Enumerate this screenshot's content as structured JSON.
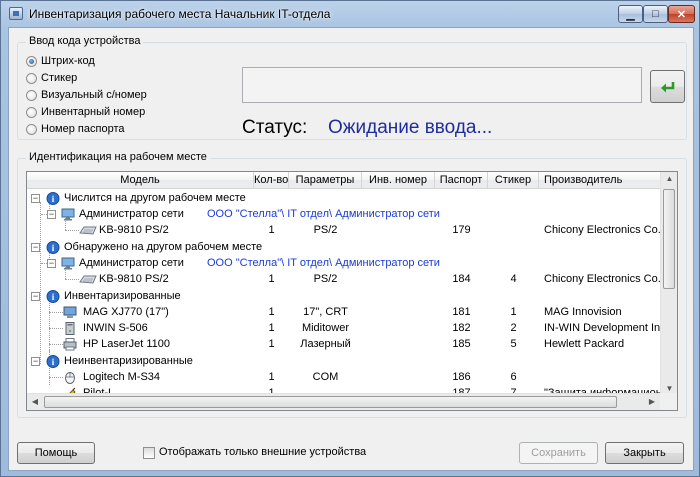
{
  "window": {
    "title": "Инвентаризация рабочего места Начальник IT-отдела",
    "min_glyph": "▁",
    "max_glyph": "□",
    "close_glyph": "✕"
  },
  "code_entry": {
    "legend": "Ввод кода устройства",
    "options": [
      {
        "label": "Штрих-код",
        "selected": true
      },
      {
        "label": "Стикер",
        "selected": false
      },
      {
        "label": "Визуальный с/номер",
        "selected": false
      },
      {
        "label": "Инвентарный номер",
        "selected": false
      },
      {
        "label": "Номер паспорта",
        "selected": false
      }
    ],
    "input_value": "",
    "status_label": "Статус:",
    "status_value": "Ожидание ввода..."
  },
  "identification": {
    "legend": "Идентификация на рабочем месте",
    "columns": [
      "Модель",
      "Кол-во",
      "Параметры",
      "Инв. номер",
      "Паспорт",
      "Стикер",
      "Производитель"
    ],
    "rows": [
      {
        "model": "Числится на другом рабочем месте",
        "qty": "",
        "params": "",
        "inv": "",
        "passport": "",
        "sticker": "",
        "maker": ""
      },
      {
        "model": "Администратор сети",
        "qty": "",
        "params": "ООО \"Стелла\"\\ IT отдел\\ Администратор сети",
        "inv": "",
        "passport": "",
        "sticker": "",
        "maker": ""
      },
      {
        "model": "KB-9810 PS/2",
        "qty": "1",
        "params": "PS/2",
        "inv": "",
        "passport": "179",
        "sticker": "",
        "maker": "Chicony Electronics Co., Ltd"
      },
      {
        "model": "Обнаружено на другом рабочем месте",
        "qty": "",
        "params": "",
        "inv": "",
        "passport": "",
        "sticker": "",
        "maker": ""
      },
      {
        "model": "Администратор сети",
        "qty": "",
        "params": "ООО \"Стелла\"\\ IT отдел\\ Администратор сети",
        "inv": "",
        "passport": "",
        "sticker": "",
        "maker": ""
      },
      {
        "model": "KB-9810 PS/2",
        "qty": "1",
        "params": "PS/2",
        "inv": "",
        "passport": "184",
        "sticker": "4",
        "maker": "Chicony Electronics Co., Ltd"
      },
      {
        "model": "Инвентаризированные",
        "qty": "",
        "params": "",
        "inv": "",
        "passport": "",
        "sticker": "",
        "maker": ""
      },
      {
        "model": "MAG XJ770 (17\")",
        "qty": "1",
        "params": "17\", CRT",
        "inv": "",
        "passport": "181",
        "sticker": "1",
        "maker": "MAG Innovision"
      },
      {
        "model": "INWIN S-506",
        "qty": "1",
        "params": "Miditower",
        "inv": "",
        "passport": "182",
        "sticker": "2",
        "maker": "IN-WIN Development Inc."
      },
      {
        "model": "HP LaserJet 1100",
        "qty": "1",
        "params": "Лазерный",
        "inv": "",
        "passport": "185",
        "sticker": "5",
        "maker": "Hewlett Packard"
      },
      {
        "model": "Неинвентаризированные",
        "qty": "",
        "params": "",
        "inv": "",
        "passport": "",
        "sticker": "",
        "maker": ""
      },
      {
        "model": "Logitech M-S34",
        "qty": "1",
        "params": "COM",
        "inv": "",
        "passport": "186",
        "sticker": "6",
        "maker": ""
      },
      {
        "model": "Pilot-L",
        "qty": "1",
        "params": "",
        "inv": "",
        "passport": "187",
        "sticker": "7",
        "maker": "\"Защита информационных ..."
      }
    ]
  },
  "footer": {
    "help": "Помощь",
    "external_only": "Отображать только внешние устройства",
    "external_only_checked": false,
    "save": "Сохранить",
    "close": "Закрыть"
  },
  "colors": {
    "status": "#1f2d9c",
    "link": "#1c3bd6",
    "enter_arrow": "#2a9a2a"
  },
  "icons": {
    "group": "info-icon",
    "workplace": "computer-icon",
    "keyboard": "keyboard-icon",
    "monitor": "monitor-icon",
    "case": "system-unit-icon",
    "printer": "printer-icon",
    "mouse": "mouse-icon",
    "ups": "power-filter-icon",
    "enter": "enter-arrow-icon"
  }
}
